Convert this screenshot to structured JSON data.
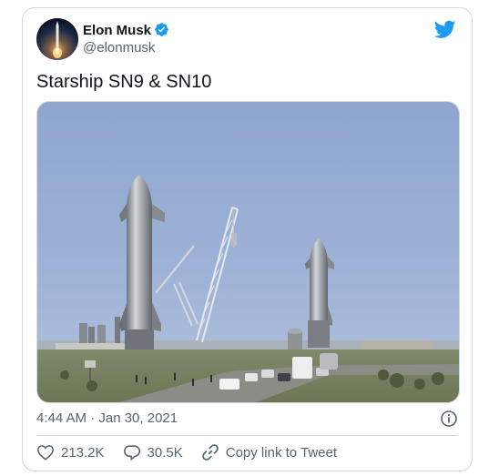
{
  "tweet": {
    "author": {
      "display_name": "Elon Musk",
      "handle": "@elonmusk",
      "verified": true
    },
    "text": "Starship SN9 & SN10",
    "timestamp": "4:44 AM · Jan 30, 2021",
    "actions": {
      "likes": "213.2K",
      "replies": "30.5K",
      "copy_link_label": "Copy link to Tweet"
    }
  },
  "colors": {
    "brand": "#1d9bf0",
    "text_primary": "#0f1419",
    "text_secondary": "#536471",
    "border": "#cfd9de"
  },
  "icons": [
    "verified-badge-icon",
    "twitter-bird-icon",
    "info-icon",
    "heart-icon",
    "reply-icon",
    "link-icon"
  ]
}
